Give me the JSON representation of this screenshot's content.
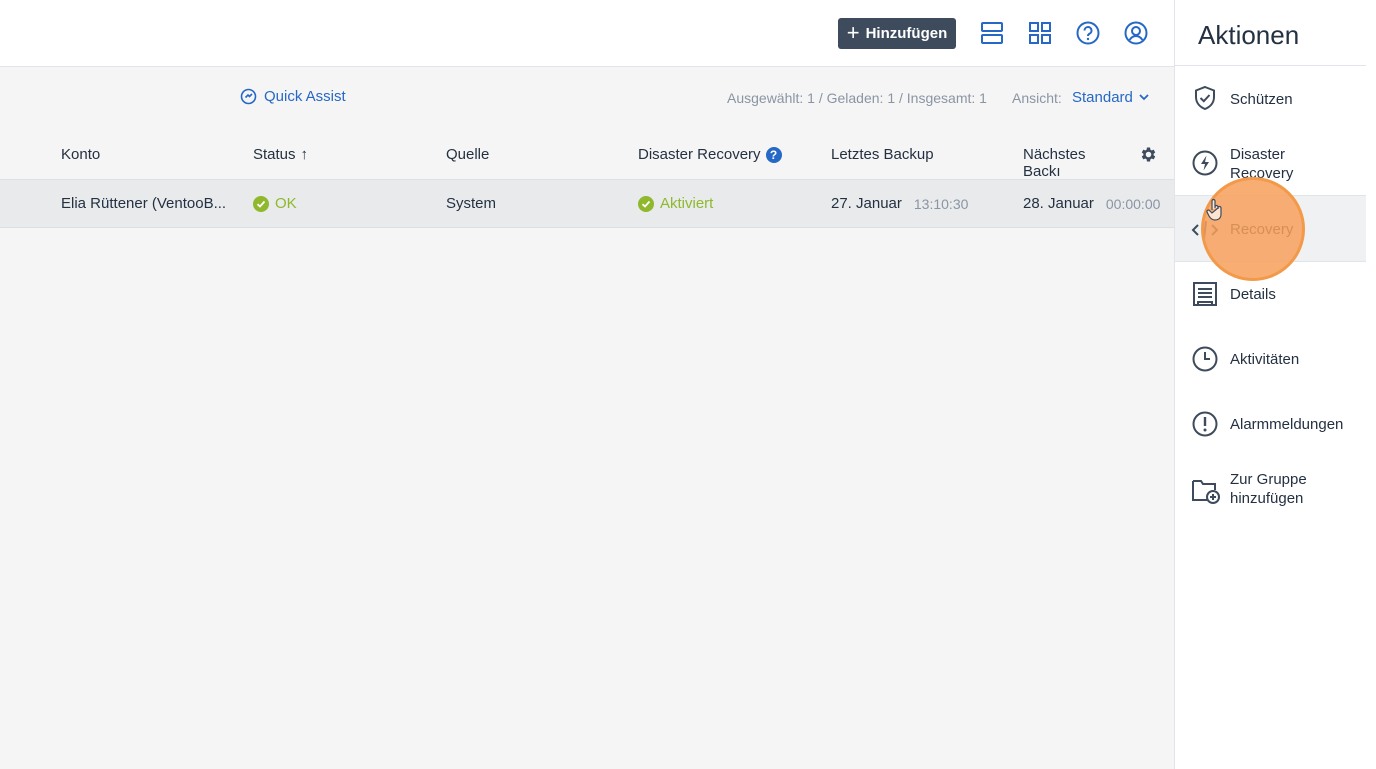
{
  "header": {
    "add_label": "Hinzufügen",
    "icons": [
      "list-view-icon",
      "grid-view-icon",
      "help-icon",
      "account-icon"
    ]
  },
  "toolbar": {
    "quick_assist": "Quick Assist",
    "counts": "Ausgewählt: 1 / Geladen: 1 / Insgesamt: 1",
    "view_label": "Ansicht:",
    "view_value": "Standard"
  },
  "table": {
    "columns": [
      "Konto",
      "Status",
      "Quelle",
      "Disaster Recovery",
      "Letztes Backup",
      "Nächstes Backı"
    ],
    "sort_arrow": "↑",
    "help_mark": "?",
    "rows": [
      {
        "konto": "Elia Rüttener (VentooB...",
        "status": "OK",
        "quelle": "System",
        "dr": "Aktiviert",
        "last_date": "27. Januar",
        "last_time": "13:10:30",
        "next_date": "28. Januar",
        "next_time": "00:00:00"
      }
    ]
  },
  "panel": {
    "title": "Aktionen",
    "actions": [
      {
        "label": "Schützen",
        "icon": "shield-icon"
      },
      {
        "label": "Disaster Recovery",
        "icon": "lightning-icon"
      },
      {
        "label": "Recovery",
        "icon": "recovery-icon"
      },
      {
        "label": "Details",
        "icon": "details-icon"
      },
      {
        "label": "Aktivitäten",
        "icon": "clock-icon"
      },
      {
        "label": "Alarmmeldungen",
        "icon": "alert-icon"
      },
      {
        "label": "Zur Gruppe hinzufügen",
        "icon": "folder-add-icon"
      }
    ]
  },
  "colors": {
    "accent": "#2668c5",
    "ok_green": "#8fb82d",
    "button_dark": "#3d4b5c",
    "highlight": "#f7a05a"
  }
}
